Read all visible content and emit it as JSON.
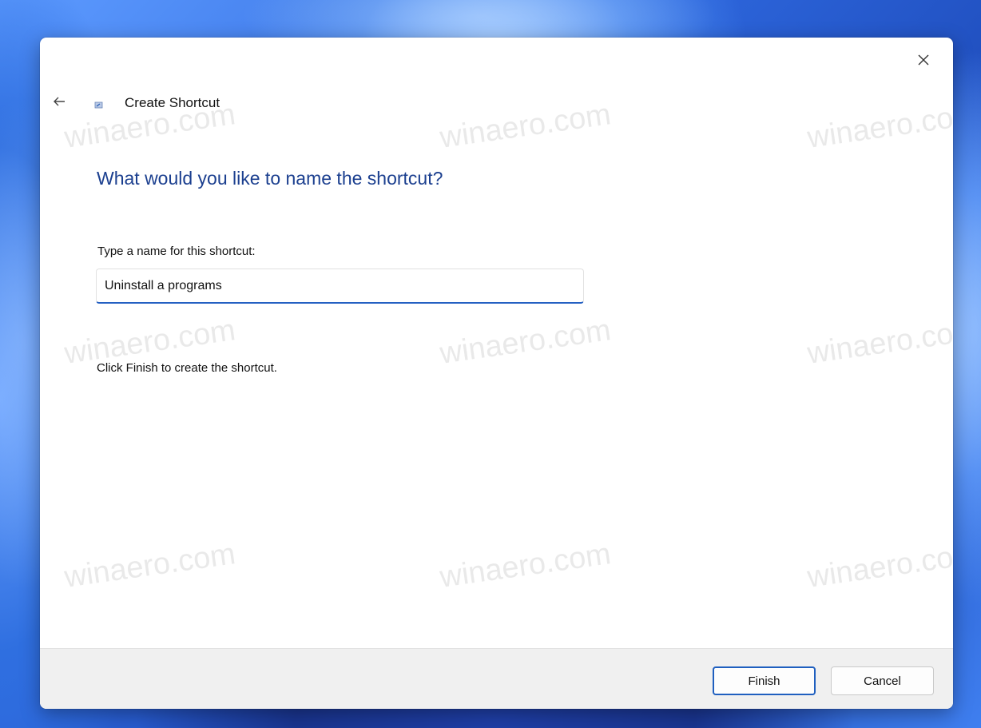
{
  "window": {
    "title": "Create Shortcut",
    "close_icon": "close-icon",
    "back_icon": "arrow-left-icon"
  },
  "page": {
    "heading": "What would you like to name the shortcut?",
    "field_label": "Type a name for this shortcut:",
    "name_value": "Uninstall a programs",
    "hint": "Click Finish to create the shortcut."
  },
  "buttons": {
    "finish_label": "Finish",
    "cancel_label": "Cancel"
  },
  "watermark": {
    "text": "winaero.com"
  },
  "colors": {
    "heading": "#1b3f8f",
    "accent": "#2460c2",
    "footer": "#f0f0f0"
  }
}
